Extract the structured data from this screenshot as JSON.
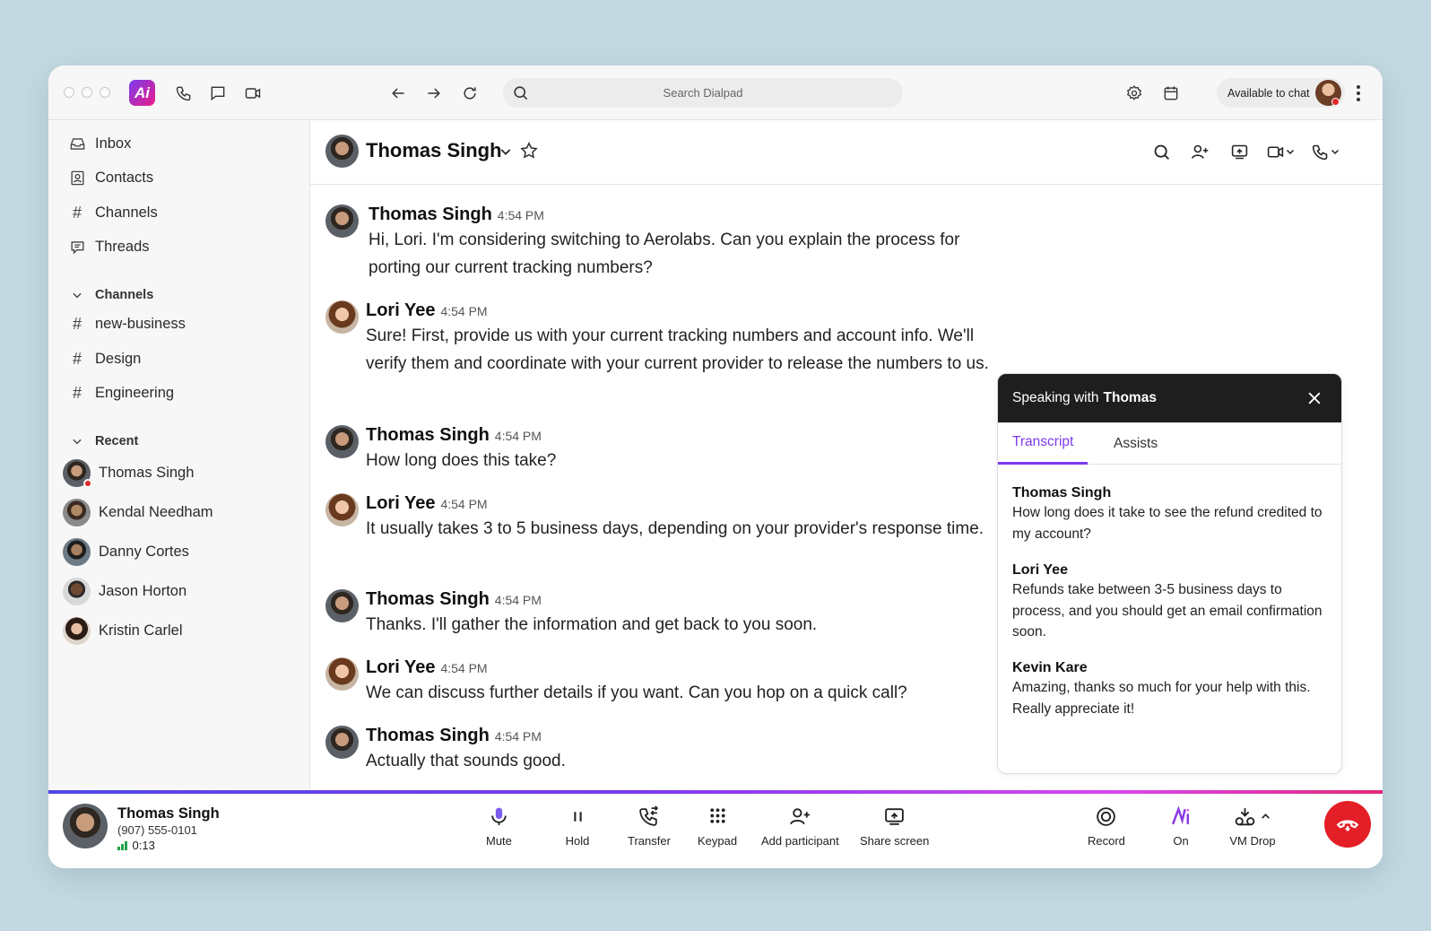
{
  "topbar": {
    "search_placeholder": "Search Dialpad",
    "status_label": "Available to chat",
    "logo_text": "Ai"
  },
  "sidebar": {
    "nav": [
      {
        "label": "Inbox",
        "icon": "inbox-icon"
      },
      {
        "label": "Contacts",
        "icon": "contacts-icon"
      },
      {
        "label": "Channels",
        "icon": "hash-icon"
      },
      {
        "label": "Threads",
        "icon": "threads-icon"
      }
    ],
    "channels_header": "Channels",
    "channels": [
      "new-business",
      "Design",
      "Engineering"
    ],
    "recent_header": "Recent",
    "recent": [
      "Thomas Singh",
      "Kendal Needham",
      "Danny Cortes",
      "Jason Horton",
      "Kristin Carlel"
    ]
  },
  "chat_header": {
    "name": "Thomas Singh"
  },
  "messages": [
    {
      "author": "Thomas Singh",
      "time": "4:54 PM",
      "text": "Hi, Lori. I'm considering switching to Aerolabs. Can you explain the process for porting our current tracking numbers?"
    },
    {
      "author": "Lori Yee",
      "time": "4:54 PM",
      "text": "Sure! First, provide us with your current tracking numbers and account info. We'll verify them and coordinate with your current provider to release the numbers to us."
    },
    {
      "author": "Thomas Singh",
      "time": "4:54 PM",
      "text": "How long does this take?"
    },
    {
      "author": "Lori Yee",
      "time": "4:54 PM",
      "text": "It usually takes 3 to 5 business days, depending on your provider's response time."
    },
    {
      "author": "Thomas Singh",
      "time": "4:54 PM",
      "text": "Thanks. I'll gather the information and get back to you soon."
    },
    {
      "author": "Lori Yee",
      "time": "4:54 PM",
      "text": "We can discuss further details if you want. Can you hop on a quick call?"
    },
    {
      "author": "Thomas Singh",
      "time": "4:54 PM",
      "text": "Actually that sounds good."
    }
  ],
  "panel": {
    "title_prefix": "Speaking with",
    "title_name": "Thomas",
    "tabs": [
      "Transcript",
      "Assists"
    ],
    "transcript": [
      {
        "speaker": "Thomas Singh",
        "text": "How long does it take to see the refund credited to my account?"
      },
      {
        "speaker": "Lori Yee",
        "text": "Refunds take between 3-5 business days to process, and you should get an email confirmation soon."
      },
      {
        "speaker": "Kevin Kare",
        "text": "Amazing, thanks so much for your help with this. Really appreciate it!"
      }
    ]
  },
  "call": {
    "name": "Thomas Singh",
    "number": "(907) 555-0101",
    "duration": "0:13",
    "controls": [
      "Mute",
      "Hold",
      "Transfer",
      "Keypad",
      "Add participant",
      "Share screen"
    ],
    "right_controls": [
      "Record",
      "On",
      "VM Drop"
    ]
  },
  "colors": {
    "accent": "#7c3aed",
    "hangup": "#e41e26",
    "presence_busy": "#e22828",
    "signal": "#22a048"
  }
}
